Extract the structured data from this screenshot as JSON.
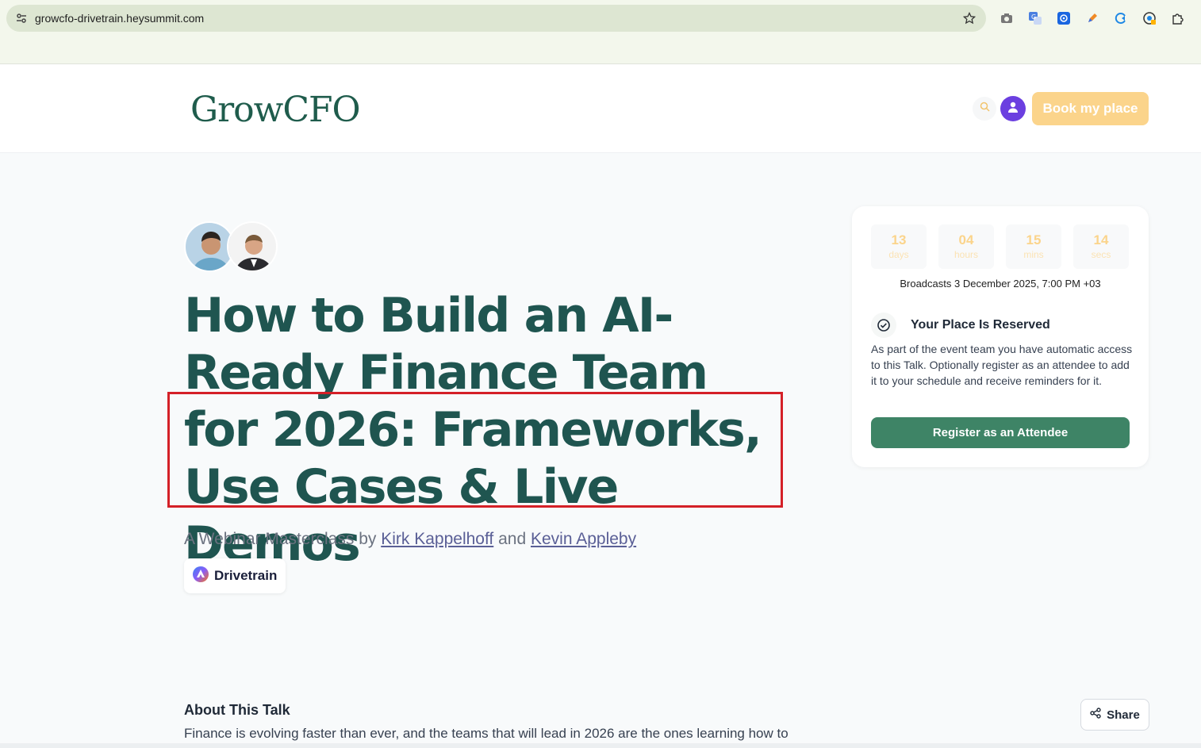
{
  "browser": {
    "url": "growcfo-drivetrain.heysummit.com",
    "icons": [
      "site-info-icon",
      "bookmark-star-icon",
      "camera-icon",
      "translate-icon",
      "extension-icon",
      "pen-icon",
      "refresh-extension-icon",
      "security-icon",
      "puzzle-icon"
    ]
  },
  "header": {
    "logo": "GrowCFO",
    "book_button": "Book my place"
  },
  "hero": {
    "title": "How to Build an AI-Ready Finance Team for 2026: Frameworks, Use Cases & Live Demos",
    "subtitle_prefix": "A Webinar Masterclass by",
    "speaker1": "Kirk Kappelhoff",
    "and": "and",
    "speaker2": "Kevin Appleby",
    "sponsor": "Drivetrain"
  },
  "card": {
    "countdown": [
      {
        "value": "13",
        "label": "days"
      },
      {
        "value": "04",
        "label": "hours"
      },
      {
        "value": "15",
        "label": "mins"
      },
      {
        "value": "14",
        "label": "secs"
      }
    ],
    "broadcast": "Broadcasts 3 December 2025, 7:00 PM +03",
    "reserved_title": "Your Place Is Reserved",
    "reserved_text": "As part of the event team you have automatic access to this Talk. Optionally register as an attendee to add it to your schedule and receive reminders for it.",
    "register_button": "Register as an Attendee"
  },
  "about": {
    "heading": "About This Talk",
    "text": "Finance is evolving faster than ever, and the teams that will lead in 2026 are the ones learning how to",
    "share_button": "Share"
  },
  "colors": {
    "brand": "#1f5c4c",
    "accent": "#fbd48b",
    "primary_button": "#3e8466",
    "highlight": "#d42027"
  }
}
